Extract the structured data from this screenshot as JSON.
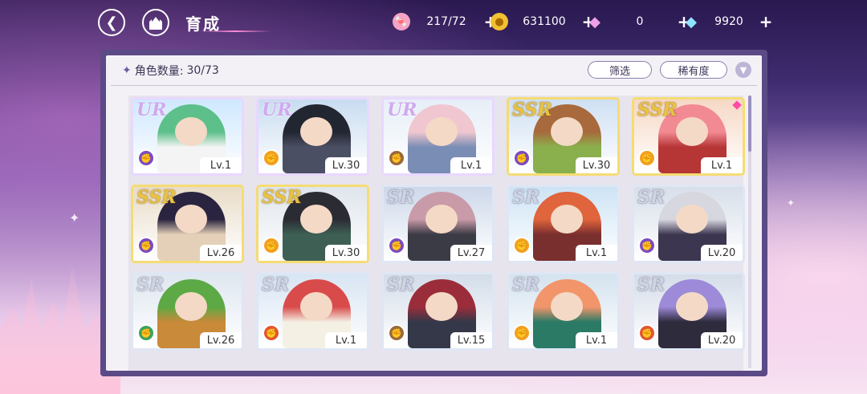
{
  "topbar": {
    "title": "育成",
    "back_icon": "back-arrow-icon",
    "home_icon": "castle-home-icon"
  },
  "resources": [
    {
      "icon": "candy-icon",
      "value": "217/72",
      "color": "#f080b0"
    },
    {
      "icon": "gold-coin-icon",
      "value": "631100",
      "color": "#f2c033"
    },
    {
      "icon": "pink-gem-icon",
      "value": "0",
      "color": "#e08bd8"
    },
    {
      "icon": "blue-diamond-icon",
      "value": "9920",
      "color": "#6fd2f0"
    }
  ],
  "panel": {
    "count_label": "角色数量:",
    "count_value": "30/73",
    "filter_label": "筛选",
    "rarity_label": "稀有度"
  },
  "characters": [
    {
      "rank": "UR",
      "level": "Lv.1",
      "attr": "purple",
      "hair": "#5dbf8a",
      "bg": "#cfe8ff",
      "cloth": "#f4f4f4"
    },
    {
      "rank": "UR",
      "level": "Lv.30",
      "attr": "orange",
      "hair": "#222631",
      "bg": "#c8dcf0",
      "cloth": "#4b4f63"
    },
    {
      "rank": "UR",
      "level": "Lv.1",
      "attr": "brown",
      "hair": "#f0c7d0",
      "bg": "#e6eef7",
      "cloth": "#7a8db5"
    },
    {
      "rank": "SSR",
      "level": "Lv.30",
      "attr": "purple",
      "hair": "#a86a3c",
      "bg": "#cfe0f3",
      "cloth": "#8ab04d"
    },
    {
      "rank": "SSR",
      "level": "Lv.1",
      "attr": "orange",
      "hair": "#f28a93",
      "bg": "#f6d8c5",
      "cloth": "#b63535"
    },
    {
      "rank": "SSR",
      "level": "Lv.26",
      "attr": "purple",
      "hair": "#2a2440",
      "bg": "#e9dcc8",
      "cloth": "#e4d0b8"
    },
    {
      "rank": "SSR",
      "level": "Lv.30",
      "attr": "orange",
      "hair": "#2b2b33",
      "bg": "#dfe5ec",
      "cloth": "#3e5f54"
    },
    {
      "rank": "SR",
      "level": "Lv.27",
      "attr": "purple",
      "hair": "#c99aa8",
      "bg": "#cdd8ea",
      "cloth": "#3b3b45"
    },
    {
      "rank": "SR",
      "level": "Lv.1",
      "attr": "orange",
      "hair": "#e0643c",
      "bg": "#cde3f5",
      "cloth": "#7a2f2f"
    },
    {
      "rank": "SR",
      "level": "Lv.20",
      "attr": "purple",
      "hair": "#d7d7e0",
      "bg": "#d7dfea",
      "cloth": "#3d3650"
    },
    {
      "rank": "SR",
      "level": "Lv.26",
      "attr": "green",
      "hair": "#5ca945",
      "bg": "#dfe7f0",
      "cloth": "#c98a3a"
    },
    {
      "rank": "SR",
      "level": "Lv.1",
      "attr": "red",
      "hair": "#d94b4b",
      "bg": "#d8e5f3",
      "cloth": "#f4f0e4"
    },
    {
      "rank": "SR",
      "level": "Lv.15",
      "attr": "brown",
      "hair": "#9b2d3a",
      "bg": "#d3dde9",
      "cloth": "#343848"
    },
    {
      "rank": "SR",
      "level": "Lv.1",
      "attr": "orange",
      "hair": "#f2956a",
      "bg": "#d4e3ef",
      "cloth": "#2a7a66"
    },
    {
      "rank": "SR",
      "level": "Lv.20",
      "attr": "red",
      "hair": "#9d8ad8",
      "bg": "#d5dde9",
      "cloth": "#2d2b3c"
    }
  ],
  "attr_colors": {
    "purple": "#7b4cc0",
    "orange": "#f2a020",
    "brown": "#9a6a3a",
    "green": "#3aa35a",
    "red": "#e2552f"
  }
}
